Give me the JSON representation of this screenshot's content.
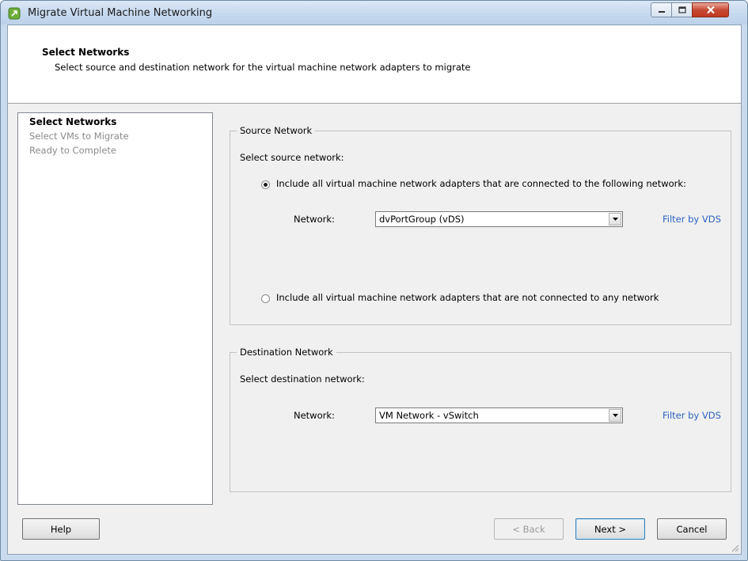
{
  "window": {
    "title": "Migrate Virtual Machine Networking",
    "controls": {
      "minimize_icon": "minimize-icon",
      "maximize_icon": "maximize-icon",
      "close_icon": "close-icon"
    }
  },
  "header": {
    "title": "Select Networks",
    "subtitle": "Select source and destination network for the virtual machine network adapters to migrate"
  },
  "steps": [
    {
      "label": "Select Networks",
      "active": true
    },
    {
      "label": "Select VMs to Migrate",
      "active": false
    },
    {
      "label": "Ready to Complete",
      "active": false
    }
  ],
  "source": {
    "legend": "Source Network",
    "prompt": "Select source network:",
    "option_connected": "Include all virtual machine network adapters that are connected to the following network:",
    "network_label": "Network:",
    "network_value": "dvPortGroup (vDS)",
    "filter_link": "Filter by VDS",
    "option_not_connected": "Include all virtual machine network adapters that are not connected to any network",
    "selected_option": "connected"
  },
  "destination": {
    "legend": "Destination Network",
    "prompt": "Select destination network:",
    "network_label": "Network:",
    "network_value": "VM Network - vSwitch",
    "filter_link": "Filter by VDS"
  },
  "buttons": {
    "help": "Help",
    "back": "< Back",
    "next": "Next >",
    "cancel": "Cancel"
  },
  "colors": {
    "link": "#2a62c3",
    "close_button": "#c74a34",
    "titlebar": "#c5d8ee"
  }
}
